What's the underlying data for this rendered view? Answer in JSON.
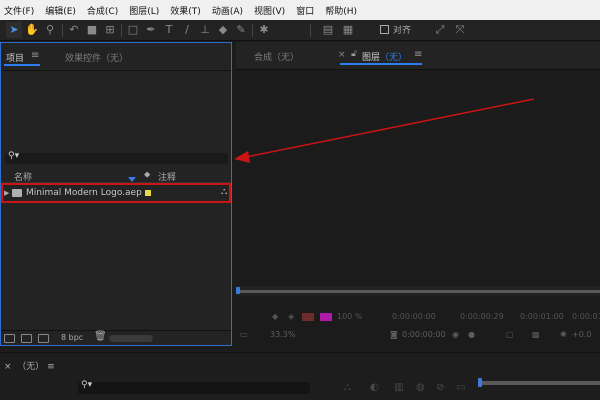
{
  "menubar": [
    "文件(F)",
    "编辑(E)",
    "合成(C)",
    "图层(L)",
    "效果(T)",
    "动画(A)",
    "视图(V)",
    "窗口",
    "帮助(H)"
  ],
  "toolbar": {
    "tools": [
      "selection-tool-icon",
      "hand-tool-icon",
      "zoom-tool-icon",
      "rotate-tool-icon",
      "camera-tool-icon",
      "pan-behind-tool-icon",
      "shape-tool-icon",
      "pen-tool-icon",
      "type-tool-icon",
      "brush-tool-icon",
      "clone-stamp-tool-icon",
      "eraser-tool-icon",
      "roto-brush-tool-icon",
      "puppet-tool-icon"
    ],
    "align_label": "对齐"
  },
  "project_panel": {
    "tab_label": "项目",
    "menu_glyph": "≡",
    "effects_tab_label": "效果控件（无）",
    "search_glyph": "⚲▾",
    "columns": {
      "name": "名称",
      "note": "注释"
    },
    "file": {
      "name": "Minimal Modern Logo.aep",
      "label_color": "#e8d94a"
    },
    "bpc": "8 bpc"
  },
  "viewer_panel": {
    "comp_tab_label": "合成（无）",
    "close_glyph": "×",
    "layer_tab_label": "图层",
    "layer_tab_suffix": "（无）",
    "menu_glyph": "≡"
  },
  "controls": {
    "zoom_percent": "100 %",
    "timecode_1": "0:00:00:00",
    "timecode_2": "0:00:00:29",
    "timecode_3": "0:00:01:00",
    "timecode_4": "0:00:01:00"
  },
  "status": {
    "magnification": "33.3%",
    "timecode": "0:00:00:00",
    "exposure": "+0.0"
  },
  "bottom_panel": {
    "tab_label": "（无）",
    "close_glyph": "×",
    "menu_glyph": "≡",
    "search_glyph": "⚲▾"
  },
  "colors": {
    "accent": "#2e7df0",
    "annotation": "#cc1414",
    "label_yellow": "#e8d94a"
  }
}
